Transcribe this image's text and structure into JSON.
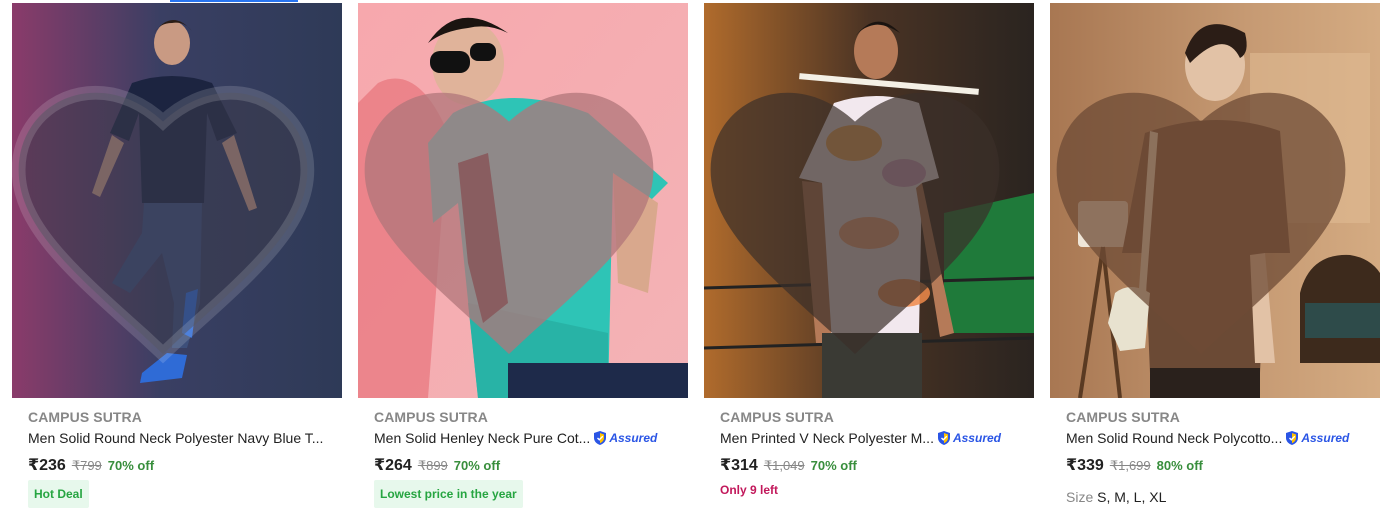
{
  "products": [
    {
      "brand": "CAMPUS SUTRA",
      "title": "Men Solid Round Neck Polyester Navy Blue T...",
      "price": "₹236",
      "mrp": "₹799",
      "discount": "70% off",
      "tag": "Hot Deal",
      "assured": false
    },
    {
      "brand": "CAMPUS SUTRA",
      "title": "Men Solid Henley Neck Pure Cot...",
      "price": "₹264",
      "mrp": "₹899",
      "discount": "70% off",
      "tag": "Lowest price in the year",
      "assured": true
    },
    {
      "brand": "CAMPUS SUTRA",
      "title": "Men Printed V Neck Polyester M...",
      "price": "₹314",
      "mrp": "₹1,049",
      "discount": "70% off",
      "stock": "Only 9 left",
      "assured": true
    },
    {
      "brand": "CAMPUS SUTRA",
      "title": "Men Solid Round Neck Polycotto...",
      "price": "₹339",
      "mrp": "₹1,699",
      "discount": "80% off",
      "size_label": "Size",
      "sizes": "S, M, L, XL",
      "assured": true
    }
  ],
  "assured_label": "Assured",
  "icons": {
    "wishlist": "heart-icon",
    "assured": "shield-icon"
  },
  "colors": {
    "discount": "#388e3c",
    "tag_bg": "#e7f8ec",
    "tag_text": "#26a541",
    "stock": "#c2185b",
    "assured": "#2a55e5"
  }
}
